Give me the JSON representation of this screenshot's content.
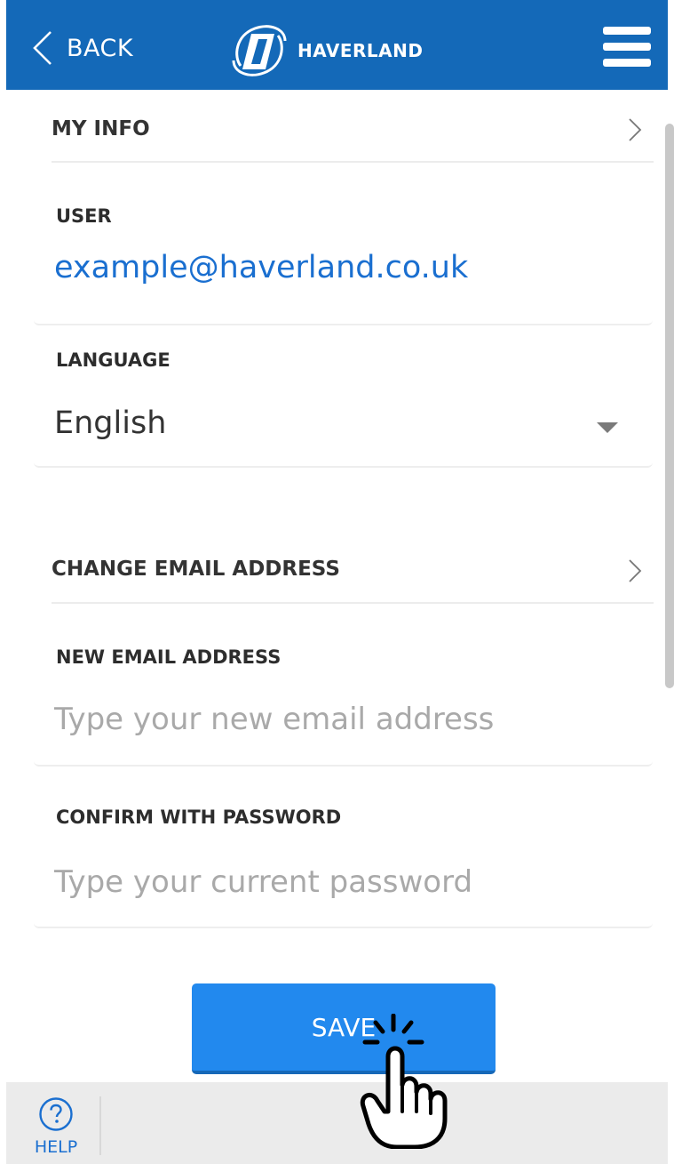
{
  "header": {
    "back_label": "BACK",
    "brand_name": "HAVERLAND",
    "background_color": "#1469b8"
  },
  "my_info": {
    "title": "MY INFO",
    "user_label": "USER",
    "user_value": "example@haverland.co.uk",
    "language_label": "LANGUAGE",
    "language_value": "English"
  },
  "change_email": {
    "title": "CHANGE EMAIL ADDRESS",
    "new_email_label": "NEW EMAIL ADDRESS",
    "new_email_placeholder": "Type your new email address",
    "new_email_value": "",
    "password_label": "CONFIRM WITH PASSWORD",
    "password_placeholder": "Type your current password",
    "password_value": ""
  },
  "actions": {
    "save_label": "SAVE",
    "accent_color": "#2289ee"
  },
  "footer": {
    "help_label": "HELP",
    "help_icon": "question-circle-icon"
  },
  "icons": {
    "back": "chevron-left-icon",
    "menu": "hamburger-menu-icon",
    "section_expand": "chevron-right-icon",
    "dropdown": "caret-down-icon",
    "pointer": "hand-pointer-click-icon"
  }
}
